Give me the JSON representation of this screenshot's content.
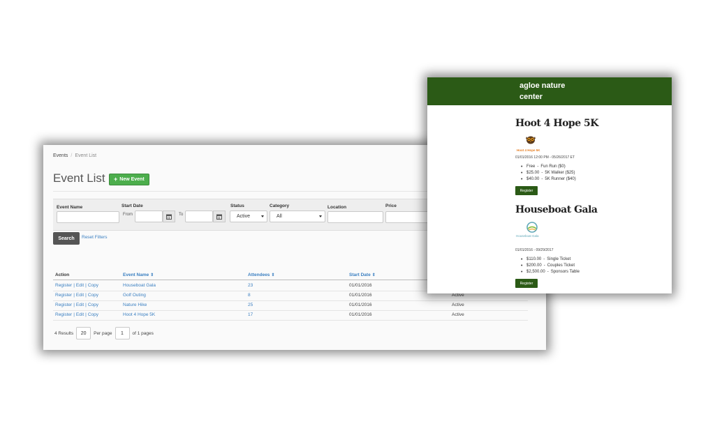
{
  "admin": {
    "breadcrumb": [
      "Events",
      "Event List"
    ],
    "title": "Event List",
    "new_event_label": "New Event",
    "filters": {
      "event_name_label": "Event Name",
      "start_date_label": "Start Date",
      "from_label": "From",
      "to_label": "To",
      "status_label": "Status",
      "status_value": "Active",
      "category_label": "Category",
      "category_value": "All",
      "location_label": "Location",
      "price_label": "Price"
    },
    "search_label": "Search",
    "reset_label": "Reset Filters",
    "columns": [
      "Action",
      "Event Name",
      "Attendees",
      "Start Date"
    ],
    "action_links": [
      "Register",
      "Edit",
      "Copy"
    ],
    "rows": [
      {
        "name": "Houseboat Gala",
        "attendees": "23",
        "start": "01/01/2016",
        "status": ""
      },
      {
        "name": "Golf Outing",
        "attendees": "8",
        "start": "01/01/2016",
        "status": "Active"
      },
      {
        "name": "Nature Hike",
        "attendees": "25",
        "start": "01/01/2016",
        "status": "Active"
      },
      {
        "name": "Hoot 4 Hope 5K",
        "attendees": "17",
        "start": "01/01/2016",
        "status": "Active"
      }
    ],
    "pager": {
      "results": "4 Results",
      "per_page_value": "20",
      "per_page_label": "Per page",
      "page_value": "1",
      "pages_label": "of 1 pages"
    }
  },
  "public": {
    "org_line1": "agloe nature",
    "org_line2": "center",
    "events": [
      {
        "title": "Hoot 4 Hope 5K",
        "logo_caption": "Hoot 4 Hope 5K",
        "dates": "01/01/2016 12:00 PM - 05/26/2017 ET",
        "tickets": [
          {
            "price": "Free",
            "name": "Fun Run ($0)"
          },
          {
            "price": "$25.00",
            "name": "5K Walker ($25)"
          },
          {
            "price": "$40.00",
            "name": "5K Runner ($40)"
          }
        ],
        "register_label": "Register"
      },
      {
        "title": "Houseboat Gala",
        "logo_caption": "Houseboat Gala",
        "dates": "01/01/2016 - 09/29/2017",
        "tickets": [
          {
            "price": "$110.00",
            "name": "Single Ticket"
          },
          {
            "price": "$200.00",
            "name": "Couples Ticket"
          },
          {
            "price": "$2,500.00",
            "name": "Sponsors Table"
          }
        ],
        "register_label": "Register"
      }
    ]
  },
  "colors": {
    "green_button": "#4cae4c",
    "header_green": "#2b5a16",
    "link_blue": "#3a7fc1"
  },
  "icons": [
    "plus-icon",
    "calendar-icon",
    "sort-icon",
    "owl-logo-icon",
    "houseboat-logo-icon"
  ]
}
